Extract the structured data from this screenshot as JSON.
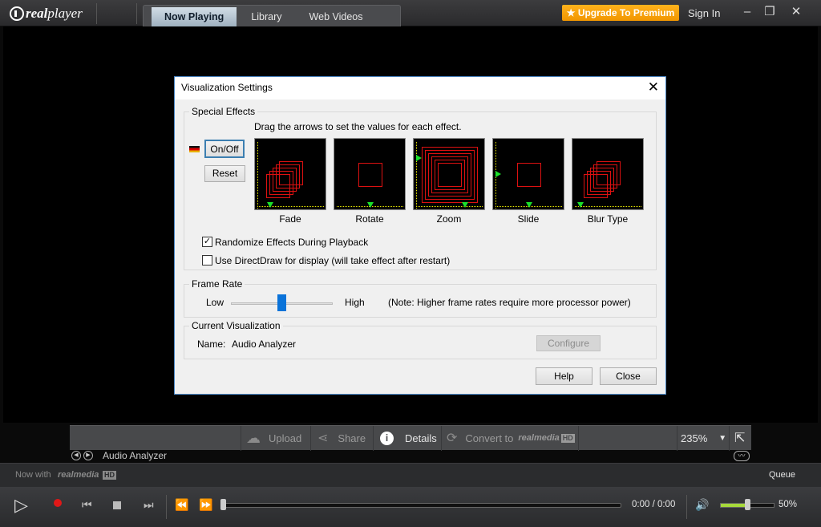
{
  "titlebar": {
    "logo_prefix": "real",
    "logo_suffix": "player",
    "tabs": [
      {
        "label": "Now Playing",
        "active": true
      },
      {
        "label": "Library",
        "active": false
      },
      {
        "label": "Web Videos",
        "active": false
      }
    ],
    "upgrade_label": "Upgrade To Premium",
    "signin_label": "Sign In",
    "minimize": "–",
    "restore": "❐",
    "close": "✕",
    "star": "★"
  },
  "dialog": {
    "title": "Visualization Settings",
    "close": "✕",
    "special_effects": {
      "legend": "Special Effects",
      "instruction": "Drag the arrows to set the values for each effect.",
      "onoff_label": "On/Off",
      "reset_label": "Reset",
      "effects": [
        {
          "name": "Fade"
        },
        {
          "name": "Rotate"
        },
        {
          "name": "Zoom"
        },
        {
          "name": "Slide"
        },
        {
          "name": "Blur Type"
        }
      ],
      "randomize_label": "Randomize Effects During Playback",
      "randomize_checked": true,
      "directdraw_label": "Use DirectDraw for display (will take effect after restart)",
      "directdraw_checked": false
    },
    "frame_rate": {
      "legend": "Frame Rate",
      "low_label": "Low",
      "high_label": "High",
      "note": "(Note: Higher frame rates require more processor power)",
      "value_fraction": 0.49
    },
    "current_visualization": {
      "legend": "Current Visualization",
      "name_label": "Name:",
      "name_value": "Audio Analyzer",
      "configure_label": "Configure"
    },
    "help_label": "Help",
    "close_label": "Close"
  },
  "infobar": {
    "upload_label": "Upload",
    "share_label": "Share",
    "details_label": "Details",
    "convert_label": "Convert to",
    "convert_brand": "realmedia",
    "convert_badge": "HD",
    "zoom_value": "235%"
  },
  "track": {
    "name": "Audio Analyzer"
  },
  "nowwith": {
    "prefix": "Now with",
    "brand": "realmedia",
    "badge": "HD",
    "queue_label": "Queue"
  },
  "controls": {
    "time": "0:00 / 0:00",
    "volume": "50%",
    "volume_fraction": 0.5,
    "seek_fraction": 0.0
  },
  "colors": {
    "accent_orange": "#f19600",
    "active_tab": "#9fb1c0",
    "viz_red": "#d11111",
    "viz_marker": "#1be02a",
    "volume_green": "#a6d93a"
  }
}
